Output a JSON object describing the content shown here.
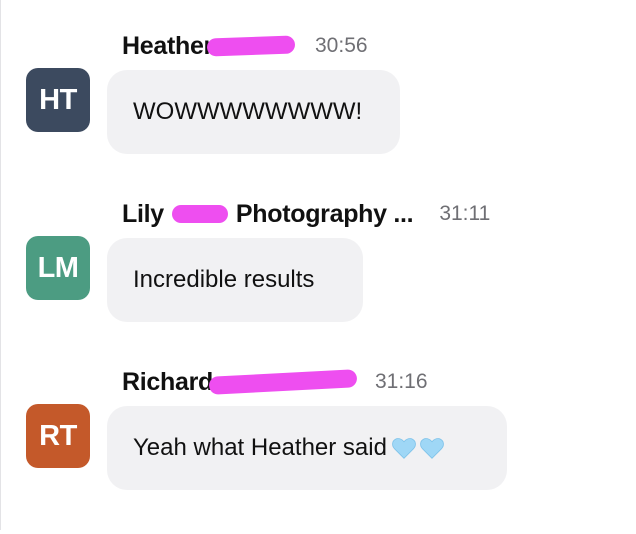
{
  "colors": {
    "avatar_ht": "#3c4a5f",
    "avatar_lm": "#4c9c82",
    "avatar_rt": "#c4592a",
    "bubble": "#f1f1f3",
    "redaction": "#ee4ef0"
  },
  "messages": [
    {
      "initials": "HT",
      "author": "Heather",
      "time": "30:56",
      "text": "WOWWWWWWWW!"
    },
    {
      "initials": "LM",
      "author_first": "Lily",
      "author_last": "Photography ...",
      "time": "31:11",
      "text": "Incredible results"
    },
    {
      "initials": "RT",
      "author": "Richard",
      "time": "31:16",
      "text": "Yeah what Heather said",
      "emoji": [
        "light-blue-heart-icon",
        "light-blue-heart-icon"
      ]
    }
  ]
}
